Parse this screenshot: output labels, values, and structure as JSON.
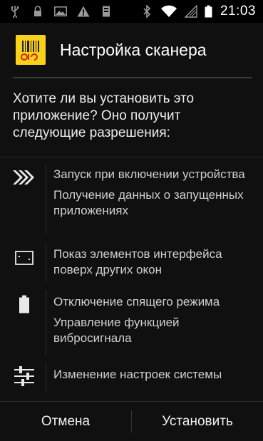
{
  "status_bar": {
    "time": "21:03",
    "icons": [
      "usb-icon",
      "lock-icon",
      "image-icon",
      "warning-icon",
      "notification-icon",
      "bluetooth-icon",
      "wifi-icon",
      "signal-icon",
      "battery-icon"
    ]
  },
  "dialog": {
    "title": "Настройка сканера",
    "question": "Хотите ли вы установить это приложение? Оно получит следующие разрешения:",
    "permission_groups": [
      {
        "icon": "apps-icon",
        "items": [
          "Запуск при включении устройства",
          "Получение данных о запущенных приложениях"
        ]
      },
      {
        "icon": "window-icon",
        "items": [
          "Показ элементов интерфейса поверх других окон"
        ]
      },
      {
        "icon": "battery-icon",
        "items": [
          "Отключение спящего режима",
          "Управление функцией вибросигнала"
        ]
      },
      {
        "icon": "settings-sliders-icon",
        "items": [
          "Изменение настроек системы"
        ]
      }
    ],
    "cancel_label": "Отмена",
    "install_label": "Установить"
  },
  "colors": {
    "background": "#101010",
    "app_icon": "#f8d21a",
    "app_icon_mark": "#d2261e"
  }
}
